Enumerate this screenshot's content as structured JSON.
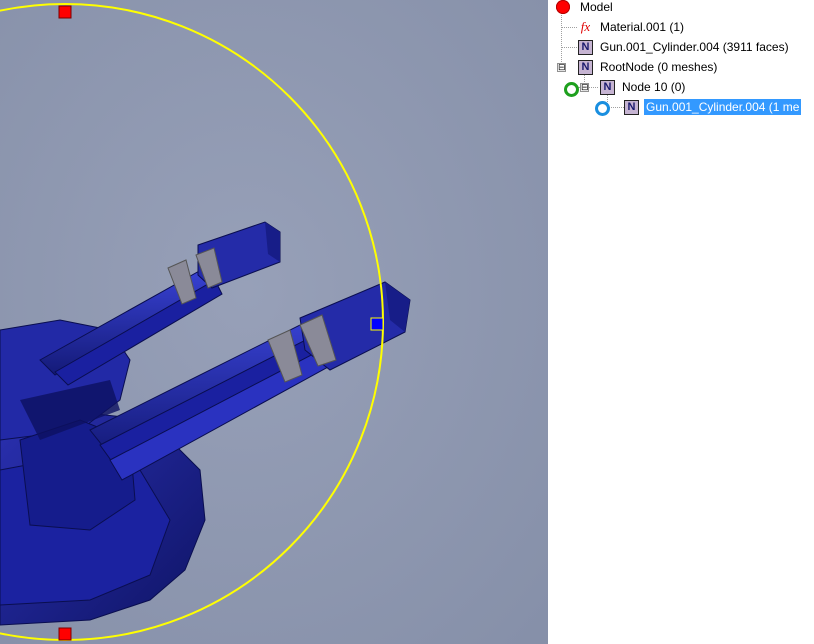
{
  "viewport": {
    "background": "#8b95ae",
    "gizmo_color": "#ffff00",
    "handle_colors": {
      "scale": "#ff0000",
      "axis": "#0000ff"
    }
  },
  "tree": {
    "items": [
      {
        "label": "Model",
        "icon": "model-dot-icon"
      },
      {
        "label": "Material.001 (1)",
        "icon": "fx-icon"
      },
      {
        "label": "Gun.001_Cylinder.004 (3911 faces)",
        "icon": "node-n-icon"
      },
      {
        "label": "RootNode (0 meshes)",
        "icon": "node-n-icon",
        "expander": "⊟"
      },
      {
        "label": "Node 10 (0)",
        "icon": "node-n-icon",
        "expander": "⊟"
      },
      {
        "label": "Gun.001_Cylinder.004 (1 me",
        "icon": "node-n-icon",
        "selected": true
      }
    ],
    "node_icon_glyph": "N",
    "fx_icon_glyph": "fx",
    "selection_color": "#3399ff"
  }
}
